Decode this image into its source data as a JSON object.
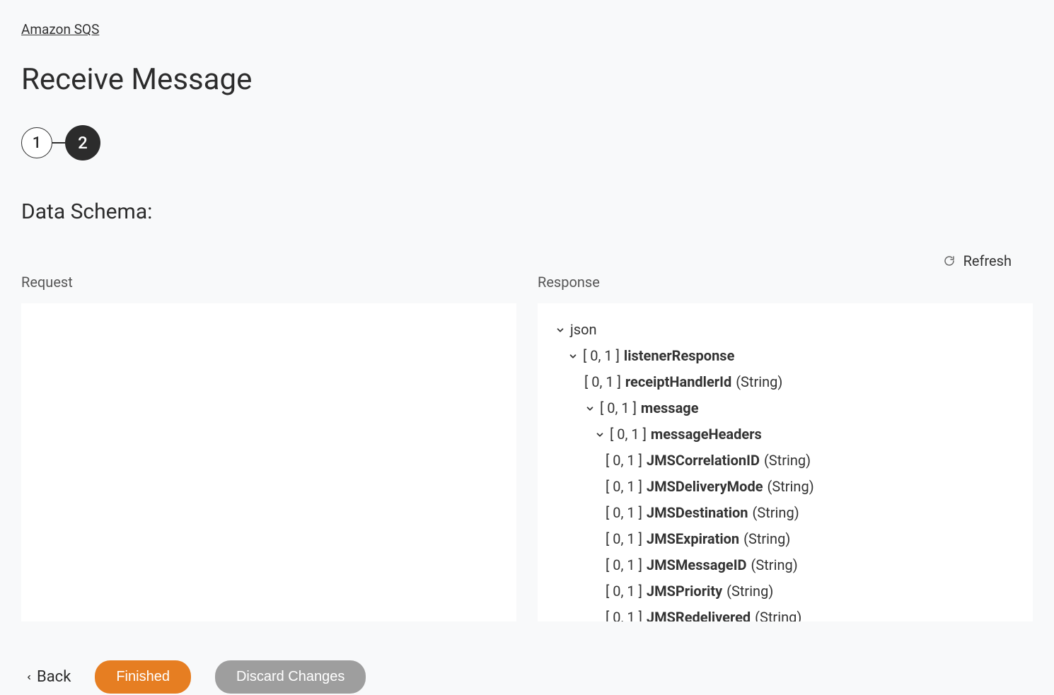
{
  "breadcrumb": "Amazon SQS",
  "page_title": "Receive Message",
  "stepper": {
    "step1": "1",
    "step2": "2"
  },
  "section_heading": "Data Schema:",
  "refresh_label": "Refresh",
  "panels": {
    "request_label": "Request",
    "response_label": "Response"
  },
  "schema": {
    "root": "json",
    "card_prefix": "[ 0, 1 ]",
    "items": {
      "listenerResponse": "listenerResponse",
      "receiptHandlerId": {
        "name": "receiptHandlerId",
        "type": "(String)"
      },
      "message": "message",
      "messageHeaders": "messageHeaders",
      "headers": [
        {
          "name": "JMSCorrelationID",
          "type": "(String)"
        },
        {
          "name": "JMSDeliveryMode",
          "type": "(String)"
        },
        {
          "name": "JMSDestination",
          "type": "(String)"
        },
        {
          "name": "JMSExpiration",
          "type": "(String)"
        },
        {
          "name": "JMSMessageID",
          "type": "(String)"
        },
        {
          "name": "JMSPriority",
          "type": "(String)"
        },
        {
          "name": "JMSRedelivered",
          "type": "(String)"
        }
      ]
    }
  },
  "footer": {
    "back": "Back",
    "finished": "Finished",
    "discard": "Discard Changes"
  }
}
